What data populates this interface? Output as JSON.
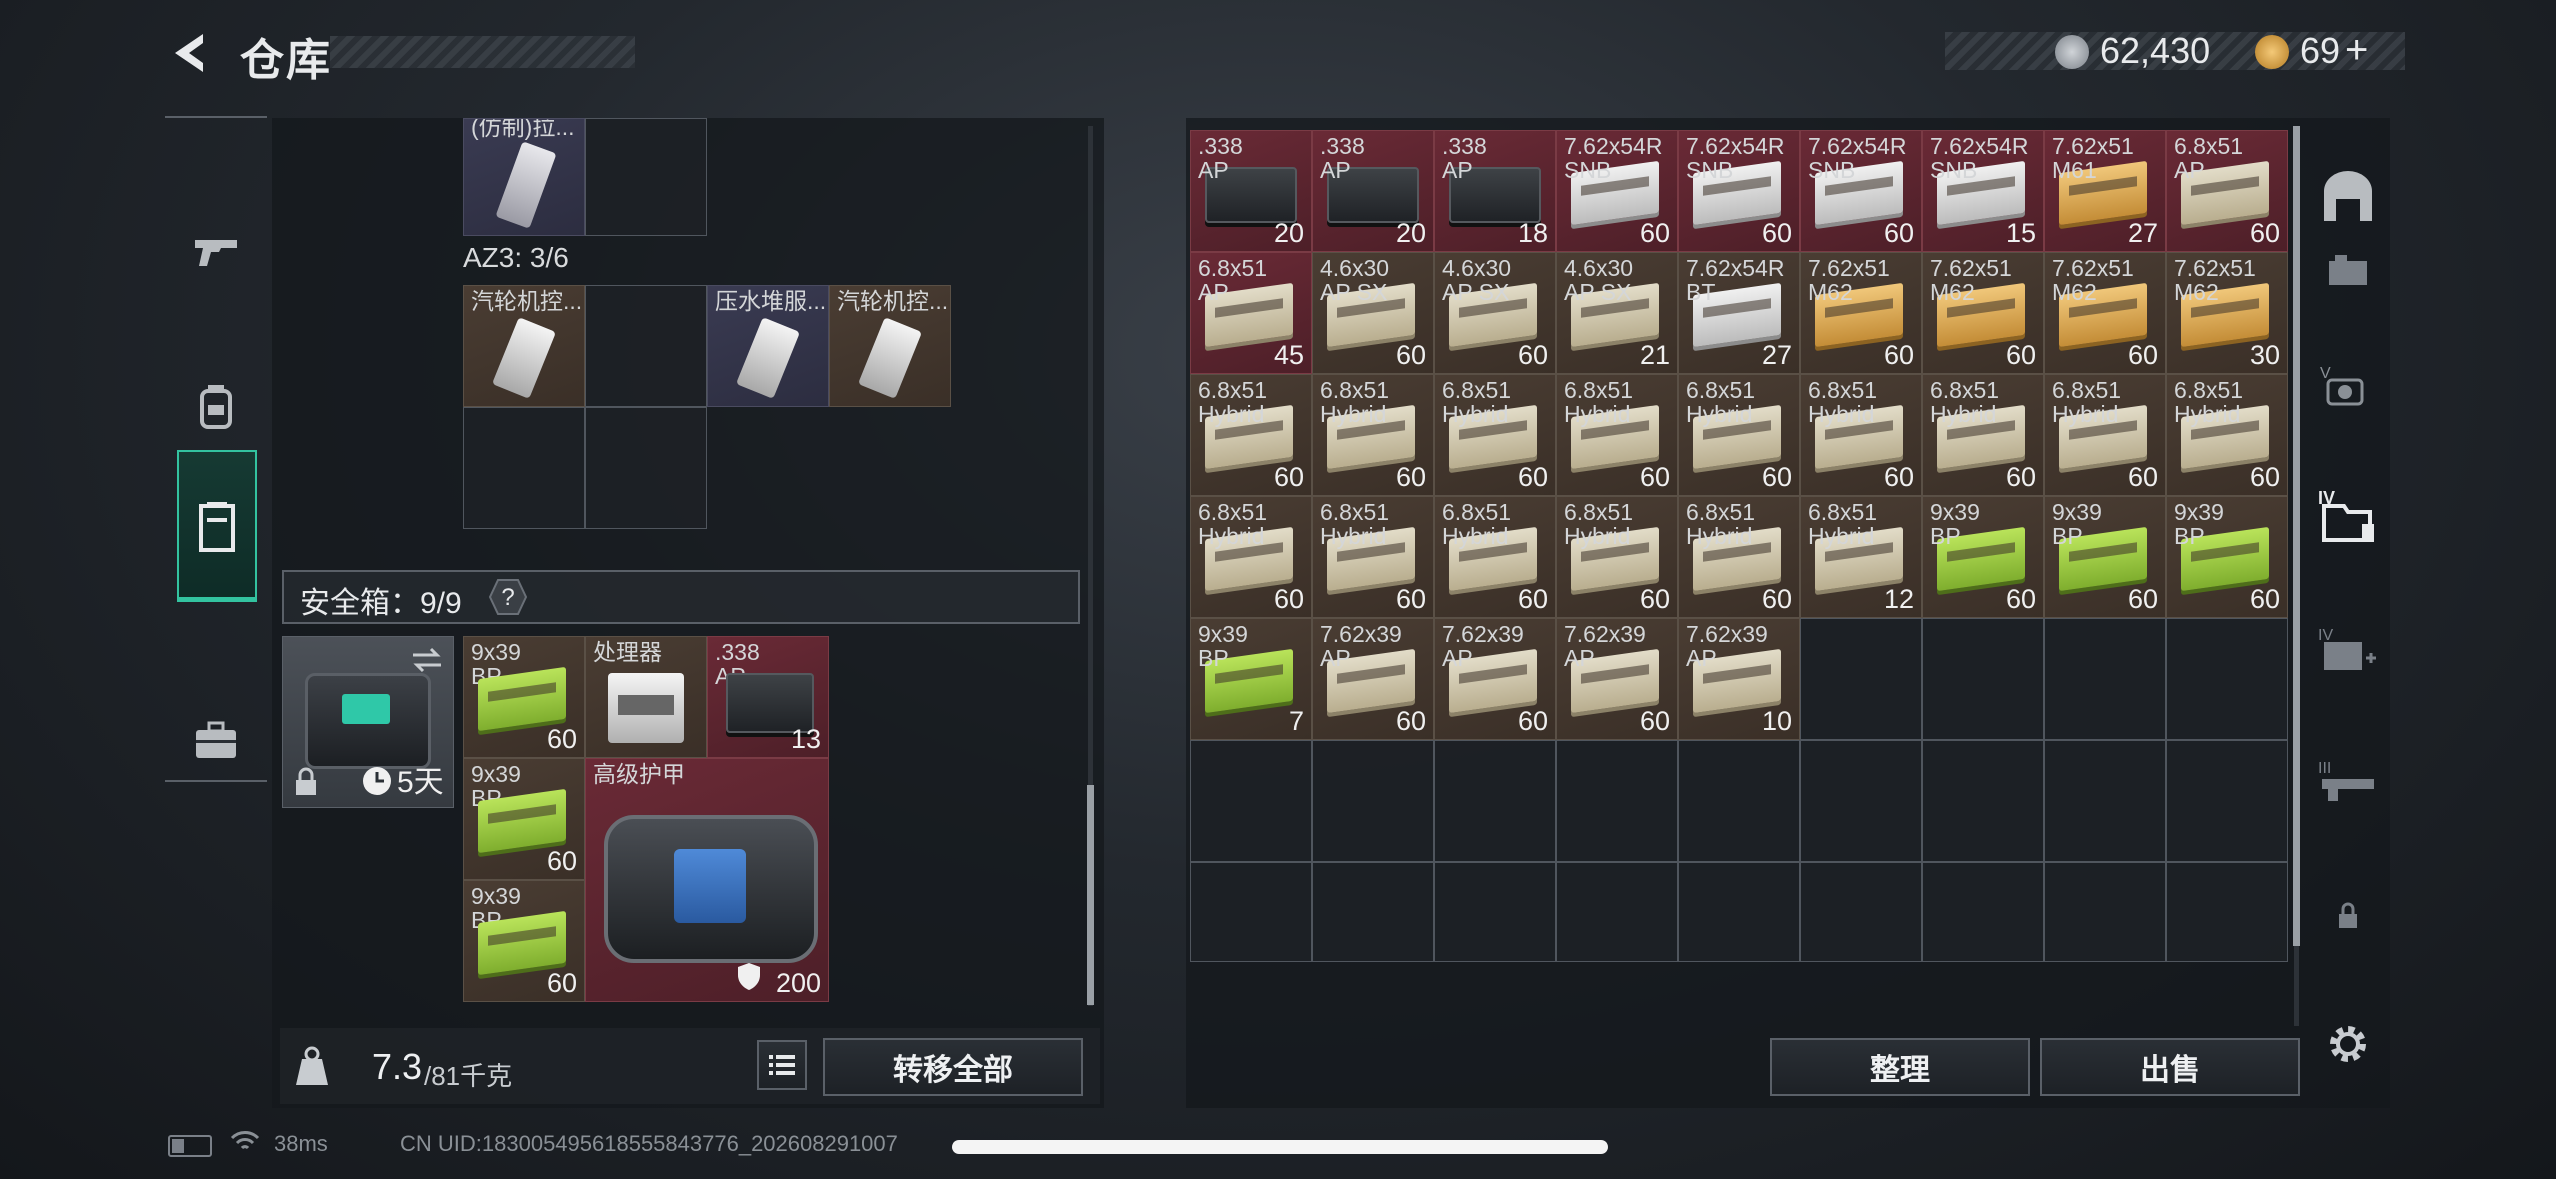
{
  "header": {
    "title": "仓库",
    "currency1": "62,430",
    "currency2": "69",
    "add_label": "+"
  },
  "colors": {
    "accent": "#33c3a0",
    "red_item": "#6a2a36",
    "brown_item": "#4a3d33"
  },
  "left_tabs": [
    {
      "name": "weapons-tab",
      "icon": "gun-icon"
    },
    {
      "name": "gear-tab",
      "icon": "backpack-icon"
    },
    {
      "name": "storage-tab",
      "icon": "locker-icon",
      "active": true
    },
    {
      "name": "case-tab",
      "icon": "briefcase-icon"
    }
  ],
  "left_panel": {
    "top_item_name": "(仿制)拉...",
    "az3_label": "AZ3: 3/6",
    "az3_items": [
      {
        "name": "汽轮机控...",
        "qty": ""
      },
      {
        "name": "压水堆服...",
        "qty": ""
      },
      {
        "name": "汽轮机控...",
        "qty": ""
      }
    ],
    "safe_label": "安全箱：9/9",
    "safe_help": "?",
    "safe_box_time": "5天",
    "safe_items": [
      {
        "name": "9x39\nBP",
        "qty": "60"
      },
      {
        "name": "处理器",
        "qty": ""
      },
      {
        "name": ".338\nAP",
        "qty": "13"
      },
      {
        "name": "9x39\nBP",
        "qty": "60"
      },
      {
        "name": "高级护甲",
        "qty": "200"
      },
      {
        "name": "9x39\nBP",
        "qty": "60"
      }
    ],
    "weight_value": "7.3",
    "weight_max": "/81千克",
    "transfer_all": "转移全部"
  },
  "right_panel": {
    "items": [
      {
        "name": ".338\nAP",
        "qty": "20",
        "bg": "red",
        "box": "black"
      },
      {
        "name": ".338\nAP",
        "qty": "20",
        "bg": "red",
        "box": "black"
      },
      {
        "name": ".338\nAP",
        "qty": "18",
        "bg": "red",
        "box": "black"
      },
      {
        "name": "7.62x54R\nSNB",
        "qty": "60",
        "bg": "red",
        "box": "white"
      },
      {
        "name": "7.62x54R\nSNB",
        "qty": "60",
        "bg": "red",
        "box": "white"
      },
      {
        "name": "7.62x54R\nSNB",
        "qty": "60",
        "bg": "red",
        "box": "white"
      },
      {
        "name": "7.62x54R\nSNB",
        "qty": "15",
        "bg": "red",
        "box": "white"
      },
      {
        "name": "7.62x51\nM61",
        "qty": "27",
        "bg": "red",
        "box": "orange"
      },
      {
        "name": "6.8x51\nAP",
        "qty": "60",
        "bg": "red",
        "box": "tan"
      },
      {
        "name": "6.8x51\nAP",
        "qty": "45",
        "bg": "red",
        "box": "tan"
      },
      {
        "name": "4.6x30\nAP SX",
        "qty": "60",
        "bg": "brown",
        "box": "tan"
      },
      {
        "name": "4.6x30\nAP SX",
        "qty": "60",
        "bg": "brown",
        "box": "tan"
      },
      {
        "name": "4.6x30\nAP SX",
        "qty": "21",
        "bg": "brown",
        "box": "tan"
      },
      {
        "name": "7.62x54R\nBT",
        "qty": "27",
        "bg": "brown",
        "box": "white"
      },
      {
        "name": "7.62x51\nM62",
        "qty": "60",
        "bg": "brown",
        "box": "orange"
      },
      {
        "name": "7.62x51\nM62",
        "qty": "60",
        "bg": "brown",
        "box": "orange"
      },
      {
        "name": "7.62x51\nM62",
        "qty": "60",
        "bg": "brown",
        "box": "orange"
      },
      {
        "name": "7.62x51\nM62",
        "qty": "30",
        "bg": "brown",
        "box": "orange"
      },
      {
        "name": "6.8x51\nHybrid",
        "qty": "60",
        "bg": "brown",
        "box": "tan"
      },
      {
        "name": "6.8x51\nHybrid",
        "qty": "60",
        "bg": "brown",
        "box": "tan"
      },
      {
        "name": "6.8x51\nHybrid",
        "qty": "60",
        "bg": "brown",
        "box": "tan"
      },
      {
        "name": "6.8x51\nHybrid",
        "qty": "60",
        "bg": "brown",
        "box": "tan"
      },
      {
        "name": "6.8x51\nHybrid",
        "qty": "60",
        "bg": "brown",
        "box": "tan"
      },
      {
        "name": "6.8x51\nHybrid",
        "qty": "60",
        "bg": "brown",
        "box": "tan"
      },
      {
        "name": "6.8x51\nHybrid",
        "qty": "60",
        "bg": "brown",
        "box": "tan"
      },
      {
        "name": "6.8x51\nHybrid",
        "qty": "60",
        "bg": "brown",
        "box": "tan"
      },
      {
        "name": "6.8x51\nHybrid",
        "qty": "60",
        "bg": "brown",
        "box": "tan"
      },
      {
        "name": "6.8x51\nHybrid",
        "qty": "60",
        "bg": "brown",
        "box": "tan"
      },
      {
        "name": "6.8x51\nHybrid",
        "qty": "60",
        "bg": "brown",
        "box": "tan"
      },
      {
        "name": "6.8x51\nHybrid",
        "qty": "60",
        "bg": "brown",
        "box": "tan"
      },
      {
        "name": "6.8x51\nHybrid",
        "qty": "60",
        "bg": "brown",
        "box": "tan"
      },
      {
        "name": "6.8x51\nHybrid",
        "qty": "60",
        "bg": "brown",
        "box": "tan"
      },
      {
        "name": "6.8x51\nHybrid",
        "qty": "12",
        "bg": "brown",
        "box": "tan"
      },
      {
        "name": "9x39\nBP",
        "qty": "60",
        "bg": "brown",
        "box": "green"
      },
      {
        "name": "9x39\nBP",
        "qty": "60",
        "bg": "brown",
        "box": "green"
      },
      {
        "name": "9x39\nBP",
        "qty": "60",
        "bg": "brown",
        "box": "green"
      },
      {
        "name": "9x39\nBP",
        "qty": "7",
        "bg": "brown",
        "box": "green"
      },
      {
        "name": "7.62x39\nAP",
        "qty": "60",
        "bg": "brown",
        "box": "tan"
      },
      {
        "name": "7.62x39\nAP",
        "qty": "60",
        "bg": "brown",
        "box": "tan"
      },
      {
        "name": "7.62x39\nAP",
        "qty": "60",
        "bg": "brown",
        "box": "tan"
      },
      {
        "name": "7.62x39\nAP",
        "qty": "10",
        "bg": "brown",
        "box": "tan"
      }
    ],
    "sort_label": "整理",
    "sell_label": "出售"
  },
  "right_rail": [
    {
      "name": "warehouse-icon"
    },
    {
      "name": "storage-2-icon"
    },
    {
      "name": "storage-5-icon"
    },
    {
      "name": "storage-4-icon",
      "active": true
    },
    {
      "name": "medical-4-icon"
    },
    {
      "name": "weapon-3-icon"
    },
    {
      "name": "lock-icon"
    },
    {
      "name": "settings-gear-icon"
    }
  ],
  "status": {
    "ping": "38ms",
    "uid": "CN UID:18300549561855584377​6_202608291007"
  }
}
